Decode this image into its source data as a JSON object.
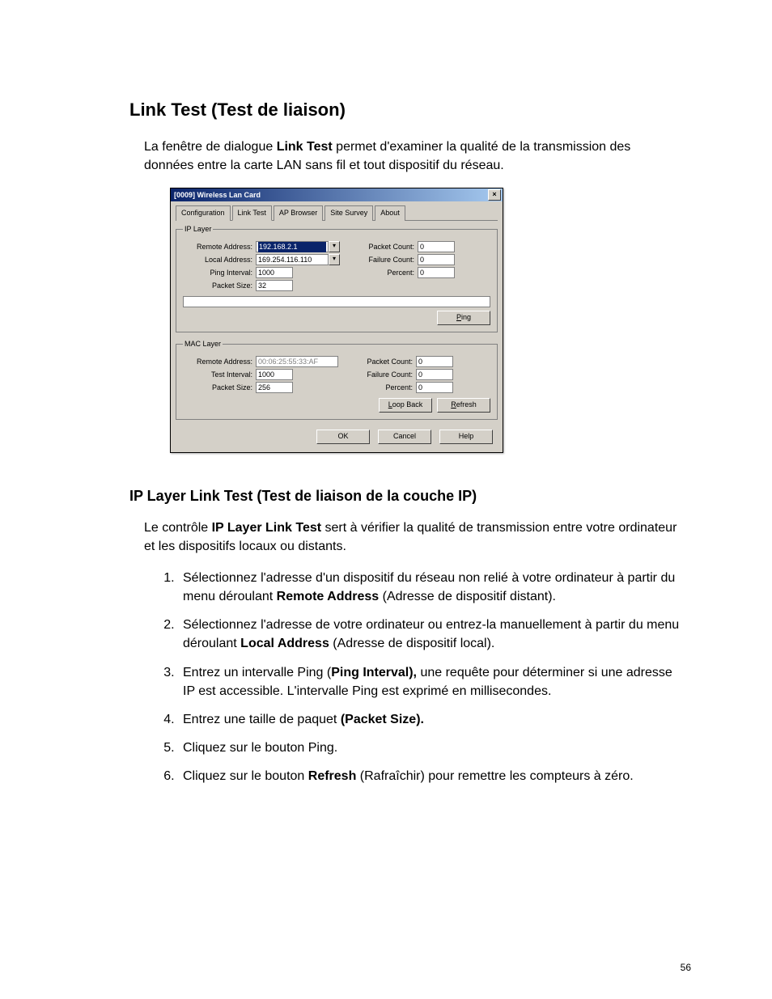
{
  "headings": {
    "h1": "Link Test (Test de liaison)",
    "h2": "IP Layer Link Test (Test de liaison de la couche IP)"
  },
  "intro": {
    "p1a": "La fenêtre de dialogue ",
    "p1b": "Link Test",
    "p1c": " permet d'examiner la qualité de la transmission des données entre la carte LAN sans fil et tout dispositif du réseau."
  },
  "ipintro": {
    "a": "Le contrôle ",
    "b": "IP Layer Link Test",
    "c": " sert à vérifier la qualité de transmission entre votre ordinateur et les dispositifs locaux ou distants."
  },
  "steps": {
    "s1a": "Sélectionnez l'adresse d'un dispositif du réseau non relié à votre ordinateur à partir du menu déroulant ",
    "s1b": "Remote Address",
    "s1c": " (Adresse de dispositif distant).",
    "s2a": "Sélectionnez l'adresse de votre ordinateur ou entrez-la manuellement à partir du menu déroulant ",
    "s2b": "Local Address",
    "s2c": " (Adresse de dispositif local).",
    "s3a": "Entrez un intervalle Ping (",
    "s3b": "Ping Interval),",
    "s3c": " une requête pour déterminer si une adresse IP est accessible. L'intervalle Ping est exprimé en millisecondes.",
    "s4a": "Entrez une taille de paquet ",
    "s4b": "(Packet Size).",
    "s5": "Cliquez sur le bouton Ping.",
    "s6a": "Cliquez sur le bouton ",
    "s6b": "Refresh",
    "s6c": " (Rafraîchir) pour remettre les compteurs à zéro."
  },
  "page_number": "56",
  "dialog": {
    "title": "[0009] Wireless Lan Card",
    "tabs": [
      "Configuration",
      "Link Test",
      "AP Browser",
      "Site Survey",
      "About"
    ],
    "ip_layer": {
      "legend": "IP Layer",
      "remote_label": "Remote Address:",
      "remote_value": "192.168.2.1",
      "local_label": "Local Address:",
      "local_value": "169.254.116.110",
      "ping_interval_label": "Ping Interval:",
      "ping_interval_value": "1000",
      "packet_size_label": "Packet Size:",
      "packet_size_value": "32",
      "packet_count_label": "Packet Count:",
      "packet_count_value": "0",
      "failure_count_label": "Failure Count:",
      "failure_count_value": "0",
      "percent_label": "Percent:",
      "percent_value": "0",
      "ping_button": "Ping"
    },
    "mac_layer": {
      "legend": "MAC Layer",
      "remote_label": "Remote Address:",
      "remote_value": "00:06:25:55:33:AF",
      "test_interval_label": "Test Interval:",
      "test_interval_value": "1000",
      "packet_size_label": "Packet Size:",
      "packet_size_value": "256",
      "packet_count_label": "Packet Count:",
      "packet_count_value": "0",
      "failure_count_label": "Failure Count:",
      "failure_count_value": "0",
      "percent_label": "Percent:",
      "percent_value": "0",
      "loopback_button": "Loop Back",
      "refresh_button": "Refresh"
    },
    "buttons": {
      "ok": "OK",
      "cancel": "Cancel",
      "help": "Help"
    }
  }
}
